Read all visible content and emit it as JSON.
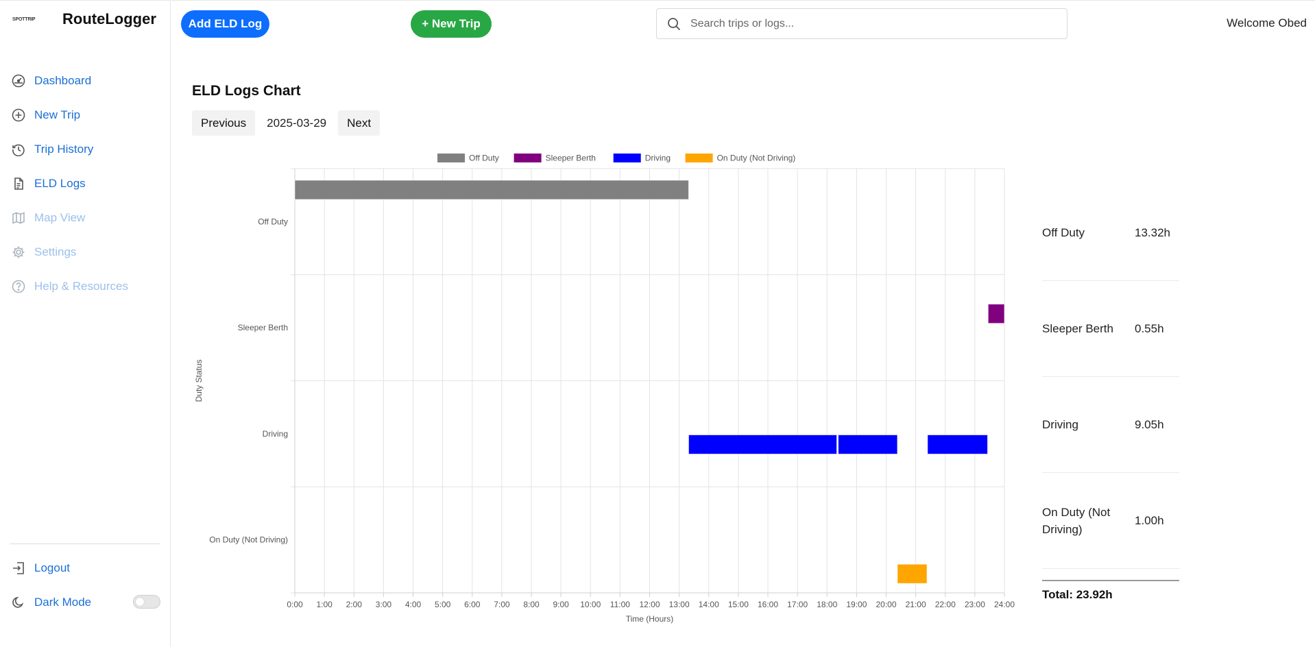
{
  "sidebar": {
    "brand_logo": "SPOTTRIP",
    "brand_name": "RouteLogger",
    "items": [
      {
        "label": "Dashboard",
        "icon": "dashboard-icon"
      },
      {
        "label": "New Trip",
        "icon": "plus-circle-icon"
      },
      {
        "label": "Trip History",
        "icon": "history-icon"
      },
      {
        "label": "ELD Logs",
        "icon": "document-icon"
      },
      {
        "label": "Map View",
        "icon": "map-icon",
        "disabled": true
      },
      {
        "label": "Settings",
        "icon": "gear-icon",
        "disabled": true
      },
      {
        "label": "Help & Resources",
        "icon": "help-icon",
        "disabled": true
      }
    ],
    "logout_label": "Logout",
    "dark_mode_label": "Dark Mode",
    "dark_mode_on": false
  },
  "topbar": {
    "add_eld_label": "Add ELD Log",
    "new_trip_label": "+ New Trip",
    "search_placeholder": "Search trips or logs...",
    "welcome": "Welcome Obed"
  },
  "colors": {
    "primary": "#0d6efd",
    "success": "#28a745",
    "link": "#1a6fd6",
    "off_duty": "#808080",
    "sleeper": "#800080",
    "driving": "#0000ff",
    "on_duty": "#ffa500"
  },
  "main": {
    "title": "ELD Logs Chart",
    "prev_label": "Previous",
    "date": "2025-03-29",
    "next_label": "Next"
  },
  "chart_data": {
    "type": "bar",
    "orientation": "horizontal-timeline",
    "xlabel": "Time (Hours)",
    "ylabel": "Duty Status",
    "xlim": [
      0,
      24
    ],
    "x_ticks": [
      "0:00",
      "1:00",
      "2:00",
      "3:00",
      "4:00",
      "5:00",
      "6:00",
      "7:00",
      "8:00",
      "9:00",
      "10:00",
      "11:00",
      "12:00",
      "13:00",
      "14:00",
      "15:00",
      "16:00",
      "17:00",
      "18:00",
      "19:00",
      "20:00",
      "21:00",
      "22:00",
      "23:00",
      "24:00"
    ],
    "categories": [
      "Off Duty",
      "Sleeper Berth",
      "Driving",
      "On Duty (Not Driving)"
    ],
    "legend_position": "top",
    "grid": true,
    "series": [
      {
        "name": "Off Duty",
        "color": "#808080",
        "segments": [
          [
            0,
            13.32
          ]
        ]
      },
      {
        "name": "Sleeper Berth",
        "color": "#800080",
        "segments": [
          [
            23.45,
            24.0
          ]
        ]
      },
      {
        "name": "Driving",
        "color": "#0000ff",
        "segments": [
          [
            13.32,
            18.33
          ],
          [
            18.38,
            20.38
          ],
          [
            21.4,
            23.43
          ]
        ]
      },
      {
        "name": "On Duty (Not Driving)",
        "color": "#ffa500",
        "segments": [
          [
            20.38,
            21.38
          ]
        ]
      }
    ]
  },
  "summary": {
    "rows": [
      {
        "label": "Off Duty",
        "value": "13.32h"
      },
      {
        "label": "Sleeper Berth",
        "value": "0.55h"
      },
      {
        "label": "Driving",
        "value": "9.05h"
      },
      {
        "label": "On Duty (Not Driving)",
        "value": "1.00h"
      }
    ],
    "total": "Total: 23.92h"
  }
}
